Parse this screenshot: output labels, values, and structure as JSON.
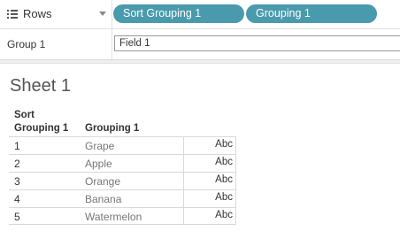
{
  "shelf": {
    "label": "Rows",
    "pills": [
      {
        "label": "Sort Grouping 1"
      },
      {
        "label": "Grouping 1"
      }
    ],
    "pill_color": "#4a9aad"
  },
  "filter": {
    "group_label": "Group 1",
    "field_value": "Field 1"
  },
  "sheet": {
    "title": "Sheet 1",
    "headers": {
      "col1_line1": "Sort",
      "col1_line2": "Grouping 1",
      "col2": "Grouping 1"
    },
    "rows": [
      {
        "sort": "1",
        "name": "Grape",
        "value": "Abc"
      },
      {
        "sort": "2",
        "name": "Apple",
        "value": "Abc"
      },
      {
        "sort": "3",
        "name": "Orange",
        "value": "Abc"
      },
      {
        "sort": "4",
        "name": "Banana",
        "value": "Abc"
      },
      {
        "sort": "5",
        "name": "Watermelon",
        "value": "Abc"
      }
    ]
  }
}
